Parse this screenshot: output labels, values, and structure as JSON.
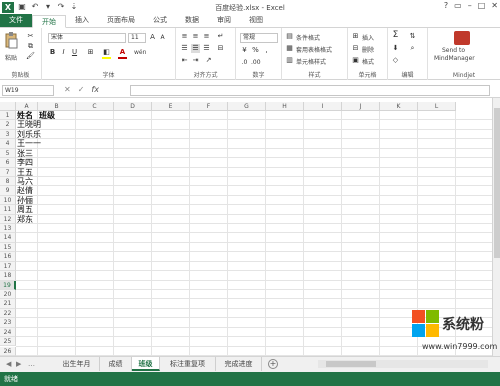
{
  "window": {
    "title": "百度经验.xlsx - Excel",
    "app_icon": "X",
    "accent": "#217346"
  },
  "ribbon_tabs": [
    "文件",
    "开始",
    "插入",
    "页面布局",
    "公式",
    "数据",
    "审阅",
    "视图"
  ],
  "ribbon": {
    "clipboard": {
      "paste": "粘贴",
      "label": "剪贴板"
    },
    "font": {
      "name": "宋体",
      "size": "11",
      "label": "字体",
      "bold": "B",
      "italic": "I",
      "underline": "U",
      "grow": "A",
      "wen": "wén"
    },
    "alignment": {
      "label": "对齐方式"
    },
    "number": {
      "format": "常规",
      "label": "数字",
      "percent": "%",
      "comma": ","
    },
    "styles": {
      "conditional": "条件格式",
      "table": "套用表格格式",
      "cell_styles": "单元格样式",
      "label": "样式"
    },
    "cells": {
      "insert": "插入",
      "delete": "删除",
      "format": "格式",
      "label": "单元格"
    },
    "editing": {
      "sum": "Σ",
      "label": "编辑"
    },
    "mindjet": {
      "line1": "Send to",
      "line2": "MindManager",
      "label": "Mindjet"
    }
  },
  "formula_bar": {
    "name_box": "W19",
    "fx": "fx",
    "value": ""
  },
  "columns": [
    "A",
    "B",
    "C",
    "D",
    "E",
    "F",
    "G",
    "H",
    "I",
    "J",
    "K",
    "L"
  ],
  "rows": [
    "1",
    "2",
    "3",
    "4",
    "5",
    "6",
    "7",
    "8",
    "9",
    "10",
    "11",
    "12",
    "13",
    "14",
    "15",
    "16",
    "17",
    "18",
    "19",
    "20",
    "21",
    "22",
    "23",
    "24",
    "25",
    "26"
  ],
  "selected_row": "19",
  "cells": {
    "A1": "姓名",
    "B1": "班级",
    "A2": "王晓明",
    "A3": "刘乐乐",
    "A4": "王一一",
    "A5": "张三",
    "A6": "李四",
    "A7": "王五",
    "A8": "马六",
    "A9": "赵倩",
    "A10": "孙俪",
    "A11": "周五",
    "A12": "郑东"
  },
  "sheet_tabs": [
    "出生年月",
    "成绩",
    "班级",
    "标注重复项",
    "完成进度"
  ],
  "active_sheet": "班级",
  "status": "就绪",
  "watermark": {
    "brand": "系统粉",
    "url": "www.win7999.com"
  }
}
